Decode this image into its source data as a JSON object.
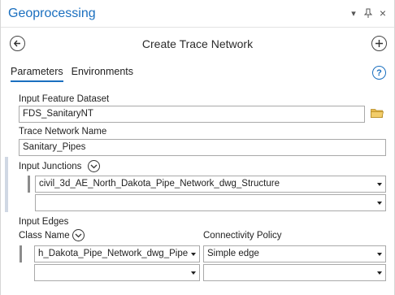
{
  "pane": {
    "title": "Geoprocessing",
    "controls": {
      "menu": "▾",
      "pin": "⊥",
      "close": "×"
    }
  },
  "header": {
    "tool_title": "Create Trace Network"
  },
  "tabs": [
    {
      "label": "Parameters",
      "active": true
    },
    {
      "label": "Environments",
      "active": false
    }
  ],
  "help": {
    "glyph": "?"
  },
  "params": {
    "input_feature_dataset": {
      "label": "Input Feature Dataset",
      "value": "FDS_SanitaryNT"
    },
    "trace_network_name": {
      "label": "Trace Network Name",
      "value": "Sanitary_Pipes"
    },
    "input_junctions": {
      "label": "Input Junctions",
      "rows": [
        "civil_3d_AE_North_Dakota_Pipe_Network_dwg_Structure",
        ""
      ]
    },
    "input_edges": {
      "label": "Input Edges",
      "class_name_label": "Class Name",
      "connectivity_label": "Connectivity Policy",
      "rows": [
        {
          "class_name": "h_Dakota_Pipe_Network_dwg_Pipe",
          "policy": "Simple edge"
        },
        {
          "class_name": "",
          "policy": ""
        }
      ]
    }
  },
  "colors": {
    "accent": "#1a6fbf",
    "folder": "#e6b84a",
    "field_border": "#a9a9a9"
  }
}
